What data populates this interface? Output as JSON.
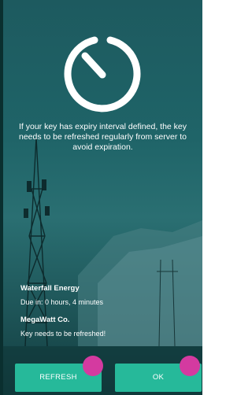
{
  "message": {
    "text": "If your key has expiry interval defined, the key needs to be refreshed regularly from server to avoid expiration."
  },
  "keys": [
    {
      "name": "Waterfall Energy",
      "status": "Due in: 0 hours, 4 minutes"
    },
    {
      "name": "MegaWatt Co.",
      "status": "Key needs to be refreshed!"
    }
  ],
  "buttons": {
    "refresh_label": "REFRESH",
    "ok_label": "OK"
  },
  "colors": {
    "accent": "#26b99a",
    "background": "#1f6468",
    "touch_indicator": "#d43aa0"
  }
}
